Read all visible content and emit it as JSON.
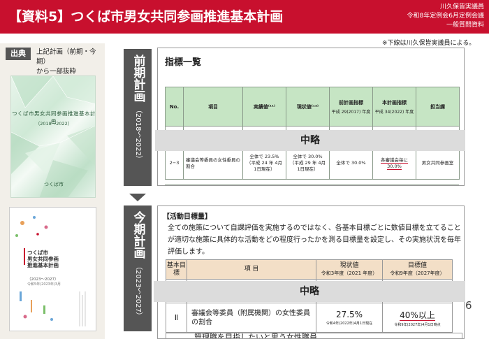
{
  "header": {
    "title": "【資料5】つくば市男女共同参画推進基本計画",
    "right_lines": [
      "川久保皆実議員",
      "令和8年定例会6月定例会議",
      "一般質問資料"
    ]
  },
  "source": {
    "badge": "出典",
    "lines": [
      "上記計画（前期・今期）",
      "から一部抜粋"
    ]
  },
  "book1": {
    "title": "つくば市男女共同参画推進基本計画",
    "period": "（2018～2022）",
    "publisher": "つくば市"
  },
  "book2": {
    "title_lines": [
      "つくば市",
      "男女共同参画",
      "推進基本計画"
    ],
    "period": "（2023～2027）",
    "date": "令和5年(2023年)3月"
  },
  "note": "※下線は川久保皆実議員による。",
  "periods": {
    "first": {
      "label": "前期計画",
      "years": "（2018〜2022）"
    },
    "current": {
      "label": "今期計画",
      "years": "（2023〜2027）"
    }
  },
  "panel1": {
    "title": "指標一覧",
    "columns": [
      {
        "main": "No.",
        "sub": ""
      },
      {
        "main": "項目",
        "sub": ""
      },
      {
        "main": "実績値⁽¹¹⁾",
        "sub": ""
      },
      {
        "main": "現状値⁽¹²⁾",
        "sub": ""
      },
      {
        "main": "前計画指標",
        "sub": "平成 29(2017) 年度"
      },
      {
        "main": "本計画指標",
        "sub": "平成 34(2022) 年度"
      },
      {
        "main": "担当課",
        "sub": ""
      }
    ],
    "row": {
      "no": "2−3",
      "item": "審議会等委員の女性委員の割合",
      "actual": "全体で 23.5%（平成 24 年 4月1日現在）",
      "current": "全体で 30.0%（平成 29 年 4月1日現在）",
      "prev_target": "全体で 30.0%",
      "target_line1": "各審議会毎に",
      "target_line2": "30.0%",
      "dept": "男女共同参画室"
    }
  },
  "omitted": "中略",
  "panel2": {
    "title": "【活動目標量】",
    "body": "全ての施策について自課評価を実施するのではなく、各基本目標ごとに数値目標を立てることが適切な施策に具体的な活動をどの程度行ったかを測る目標量を設定し、その実施状況を毎年評価します。",
    "columns": [
      {
        "main": "基本目標",
        "sub": ""
      },
      {
        "main": "項 目",
        "sub": ""
      },
      {
        "main": "現状値",
        "sub": "令和3年度（2021 年度）"
      },
      {
        "main": "目標値",
        "sub": "令和9年度（2027年度）"
      }
    ],
    "row": {
      "goal": "Ⅱ",
      "item": "審議会等委員（附属機関）の女性委員の割合",
      "current": "27.5%",
      "current_note": "令和4年(2022年)4月1日現在",
      "target": "40%以上",
      "target_note": "令和9年(2027年)4月1日時点"
    },
    "cut_row_text": "管理職を目指したいと思う女性職員"
  },
  "page_number": "6"
}
